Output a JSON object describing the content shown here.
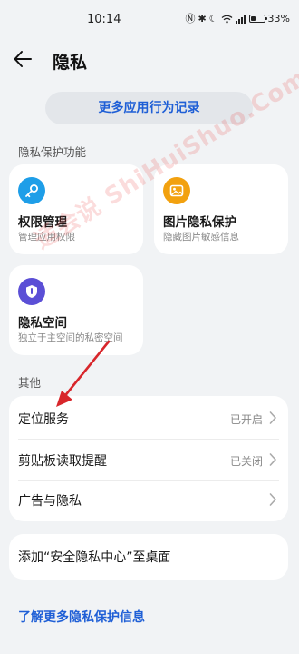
{
  "status_bar": {
    "time": "10:14",
    "battery": "33%",
    "battery_level": 0.33
  },
  "header": {
    "title": "隐私",
    "back_icon": "arrow-left-icon"
  },
  "more_records_button": "更多应用行为记录",
  "privacy_section": {
    "title": "隐私保护功能",
    "cards": [
      {
        "title": "权限管理",
        "subtitle": "管理应用权限",
        "icon": "key-icon",
        "color": "#1e9ee8"
      },
      {
        "title": "图片隐私保护",
        "subtitle": "隐藏图片敏感信息",
        "icon": "image-icon",
        "color": "#f2a10f"
      },
      {
        "title": "隐私空间",
        "subtitle": "独立于主空间的私密空间",
        "icon": "shield-icon",
        "color": "#5b4fd6"
      }
    ]
  },
  "other_section": {
    "title": "其他",
    "rows": [
      {
        "label": "定位服务",
        "status": "已开启"
      },
      {
        "label": "剪贴板读取提醒",
        "status": "已关闭"
      },
      {
        "label": "广告与隐私",
        "status": ""
      }
    ]
  },
  "shortcut": "添加“安全隐私中心”至桌面",
  "learn_more_link": "了解更多隐私保护信息",
  "watermark": {
    "text": "适会说 ShiHuiShuo.Com",
    "color": "#eb3c3c"
  },
  "colors": {
    "accent": "#1f5fd6",
    "background": "#f1f3f5",
    "card": "#ffffff"
  }
}
